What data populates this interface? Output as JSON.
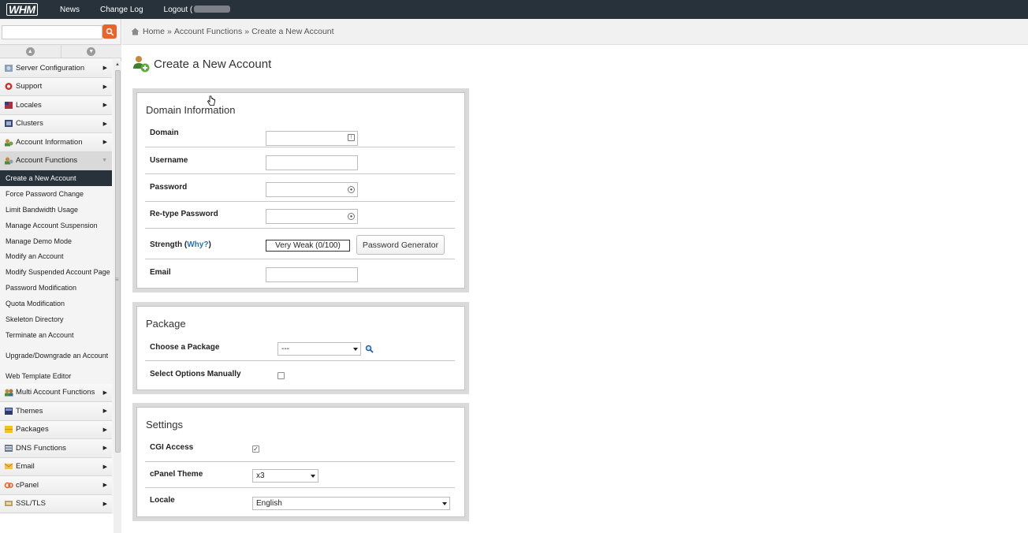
{
  "topbar": {
    "logo": "WHM",
    "nav": [
      "News",
      "Change Log",
      "Logout ("
    ],
    "colors": {
      "bar": "#28323b"
    }
  },
  "sidebar": {
    "search_placeholder": "",
    "categories_top": [
      {
        "label": "Server Configuration",
        "icon": "server-config-icon"
      },
      {
        "label": "Support",
        "icon": "support-icon"
      },
      {
        "label": "Locales",
        "icon": "locales-icon"
      },
      {
        "label": "Clusters",
        "icon": "clusters-icon"
      },
      {
        "label": "Account Information",
        "icon": "account-info-icon"
      },
      {
        "label": "Account Functions",
        "icon": "account-functions-icon"
      }
    ],
    "subitems": [
      "Create a New Account",
      "Force Password Change",
      "Limit Bandwidth Usage",
      "Manage Account Suspension",
      "Manage Demo Mode",
      "Modify an Account",
      "Modify Suspended Account Page",
      "Password Modification",
      "Quota Modification",
      "Skeleton Directory",
      "Terminate an Account",
      "Upgrade/Downgrade an Account",
      "Web Template Editor"
    ],
    "categories_bottom": [
      {
        "label": "Multi Account Functions",
        "icon": "multi-account-icon"
      },
      {
        "label": "Themes",
        "icon": "themes-icon"
      },
      {
        "label": "Packages",
        "icon": "packages-icon"
      },
      {
        "label": "DNS Functions",
        "icon": "dns-icon"
      },
      {
        "label": "Email",
        "icon": "email-icon"
      },
      {
        "label": "cPanel",
        "icon": "cpanel-icon"
      },
      {
        "label": "SSL/TLS",
        "icon": "ssl-icon"
      }
    ],
    "active_item": "Create a New Account"
  },
  "breadcrumb": {
    "home": "Home",
    "section": "Account Functions",
    "current": "Create a New Account"
  },
  "page": {
    "title": "Create a New Account"
  },
  "domain_info": {
    "title": "Domain Information",
    "domain_label": "Domain",
    "domain_value": "",
    "username_label": "Username",
    "username_value": "",
    "password_label": "Password",
    "password_value": "",
    "retype_label": "Re-type Password",
    "retype_value": "",
    "strength_label": "Strength (",
    "strength_why": "Why?",
    "strength_close": ")",
    "strength_value": "Very Weak (0/100)",
    "generator_button": "Password Generator",
    "email_label": "Email",
    "email_value": ""
  },
  "package": {
    "title": "Package",
    "choose_label": "Choose a Package",
    "choose_value": "---",
    "manual_label": "Select Options Manually",
    "manual_checked": false
  },
  "settings": {
    "title": "Settings",
    "cgi_label": "CGI Access",
    "cgi_checked": true,
    "cgi_mark": "✓",
    "theme_label": "cPanel Theme",
    "theme_value": "x3",
    "locale_label": "Locale",
    "locale_value": "English"
  }
}
